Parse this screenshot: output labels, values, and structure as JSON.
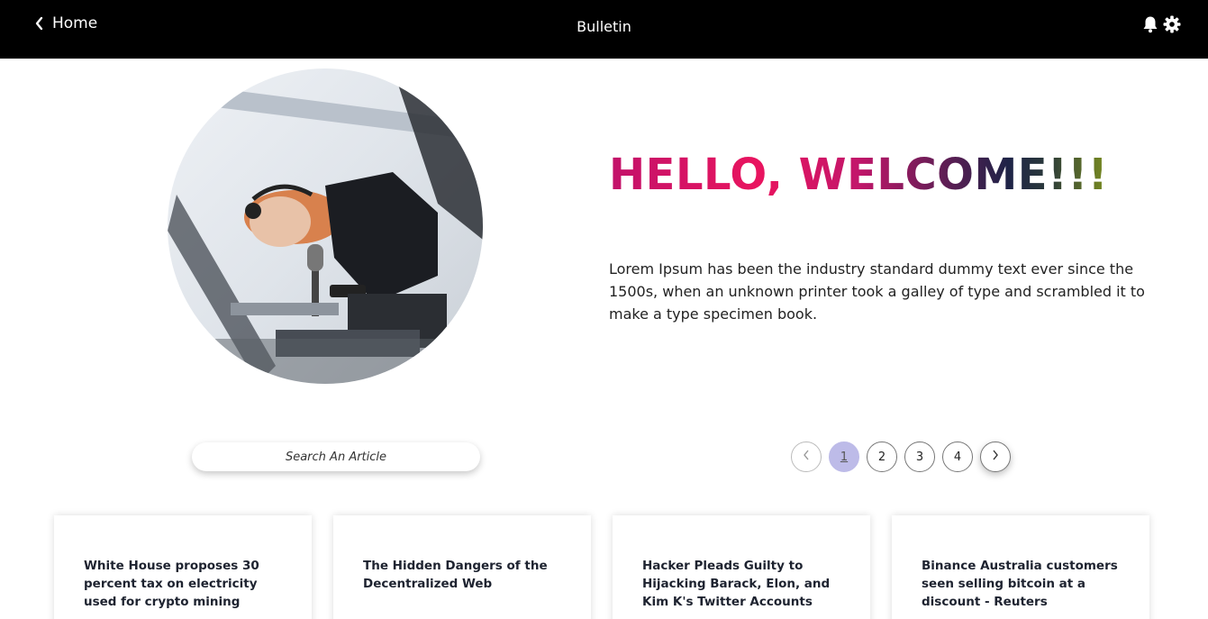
{
  "header": {
    "back_label": "Home",
    "title": "Bulletin",
    "icons": [
      "chevron-left-icon",
      "bell-icon",
      "gear-icon"
    ]
  },
  "hero": {
    "heading": "HELLO, WELCOME!!!",
    "body": "Lorem Ipsum has been the industry standard dummy text ever since the 1500s, when an unknown printer took a galley of type and scrambled it to make a type specimen book."
  },
  "search": {
    "placeholder": "Search An Article"
  },
  "pagination": {
    "pages": [
      "1",
      "2",
      "3",
      "4"
    ],
    "current": "1"
  },
  "articles": [
    {
      "title": "White House proposes 30 percent tax on electricity used for crypto mining"
    },
    {
      "title": "The Hidden Dangers of the Decentralized Web"
    },
    {
      "title": "Hacker Pleads Guilty to Hijacking Barack, Elon, and Kim K's Twitter Accounts"
    },
    {
      "title": "Binance Australia customers seen selling bitcoin at a discount - Reuters"
    }
  ],
  "colors": {
    "header_bg": "#000000",
    "active_page": "#bdbbe8",
    "heading_gradient": [
      "#e9145f",
      "#1e2347",
      "#7a8d1f"
    ]
  }
}
